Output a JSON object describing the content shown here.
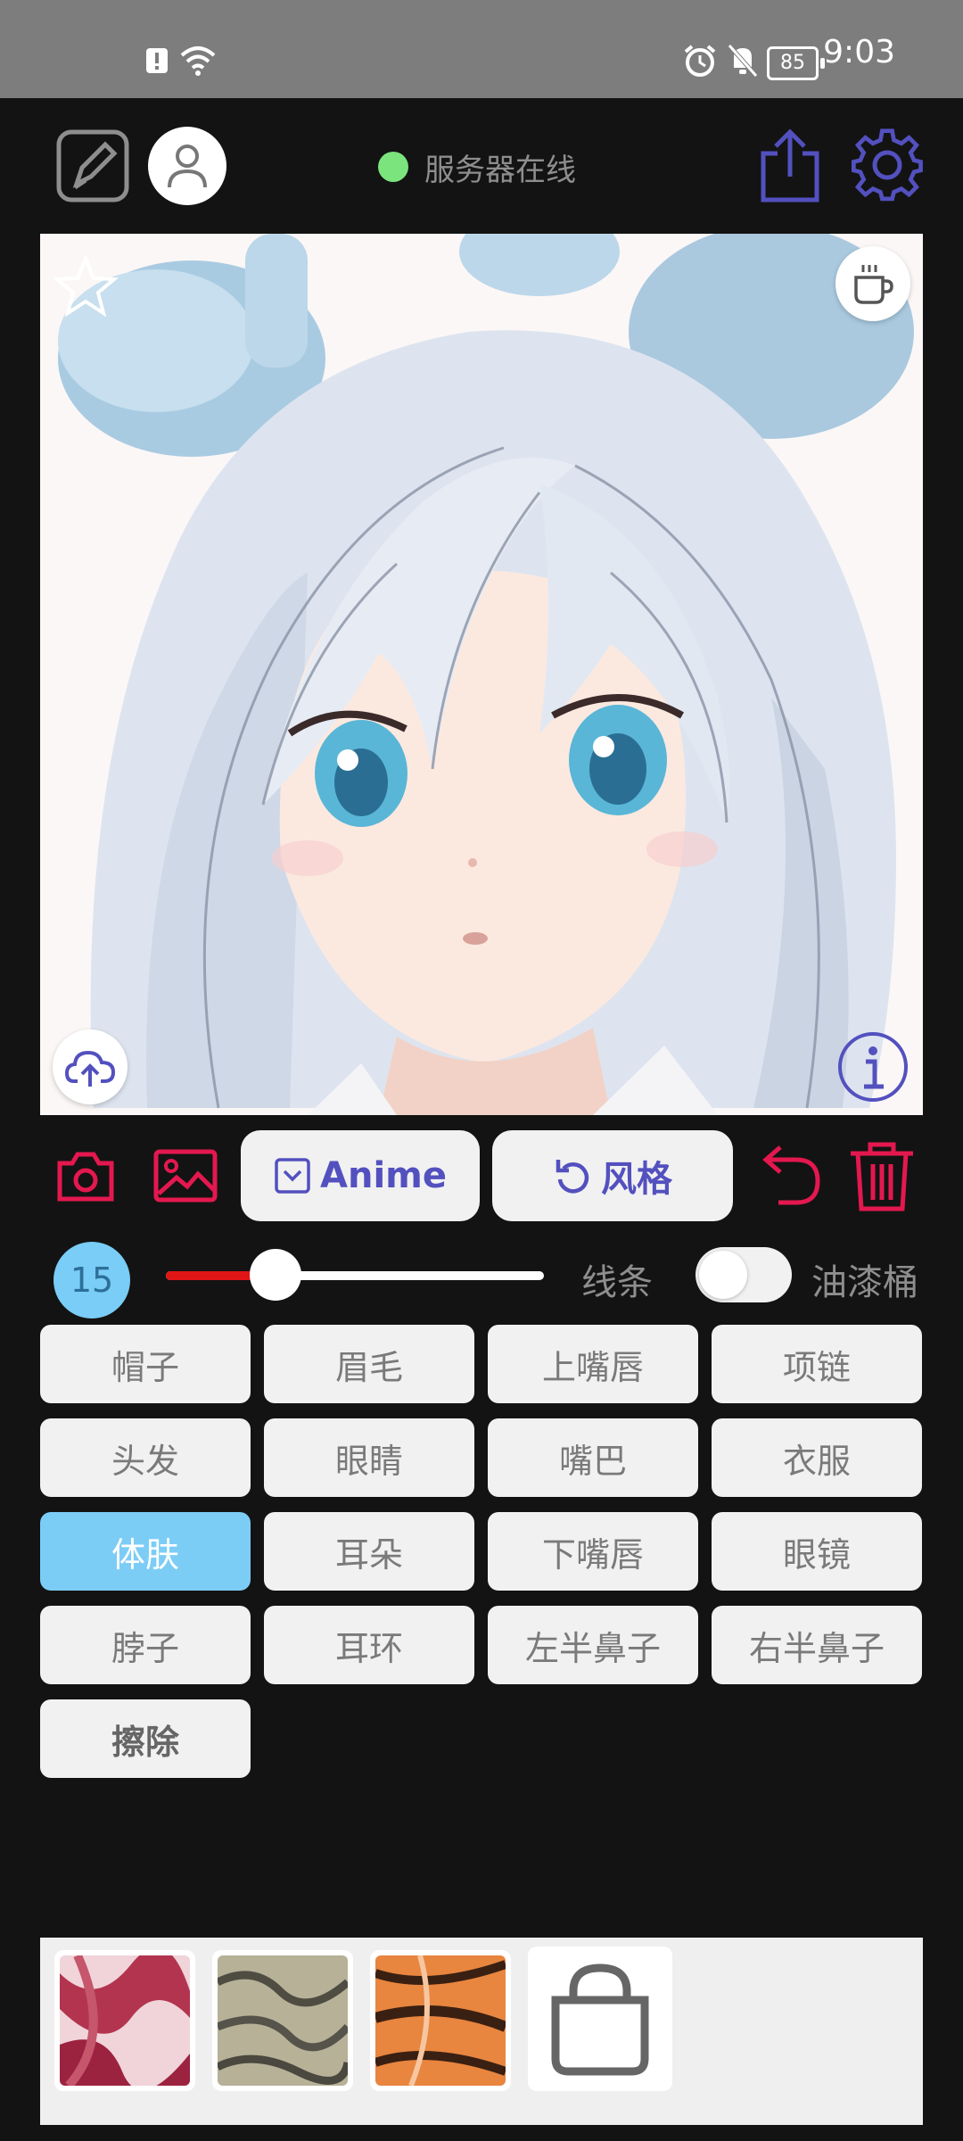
{
  "status_bar": {
    "time": "9:03",
    "battery": "85"
  },
  "header": {
    "server_status": "服务器在线",
    "server_status_color": "#7be47d"
  },
  "toolbar": {
    "model_button": "Anime",
    "style_button": "风格",
    "accent_color": "#e4184f",
    "primary_color": "#5350bf"
  },
  "brush": {
    "size": "15",
    "slider_fraction": 0.29,
    "slider_color": "#e01515"
  },
  "options": {
    "lines_label": "线条",
    "bucket_label": "油漆桶",
    "bucket_enabled": false
  },
  "parts": [
    {
      "label": "帽子"
    },
    {
      "label": "眉毛"
    },
    {
      "label": "上嘴唇"
    },
    {
      "label": "项链"
    },
    {
      "label": "头发"
    },
    {
      "label": "眼睛"
    },
    {
      "label": "嘴巴"
    },
    {
      "label": "衣服"
    },
    {
      "label": "体肤",
      "selected": true
    },
    {
      "label": "耳朵"
    },
    {
      "label": "下嘴唇"
    },
    {
      "label": "眼镜"
    },
    {
      "label": "脖子"
    },
    {
      "label": "耳环"
    },
    {
      "label": "左半鼻子"
    },
    {
      "label": "右半鼻子"
    },
    {
      "label": "擦除"
    }
  ],
  "selected_part_color": "#7ccdf6",
  "textures": [
    {
      "name": "red-marble-texture",
      "colors": [
        "#b3344f",
        "#f3d7dc"
      ]
    },
    {
      "name": "gray-stone-texture",
      "colors": [
        "#a8a488",
        "#55534a"
      ]
    },
    {
      "name": "orange-tiger-texture",
      "colors": [
        "#e27a3c",
        "#3a2012"
      ]
    },
    {
      "name": "shop-bag-icon"
    }
  ]
}
